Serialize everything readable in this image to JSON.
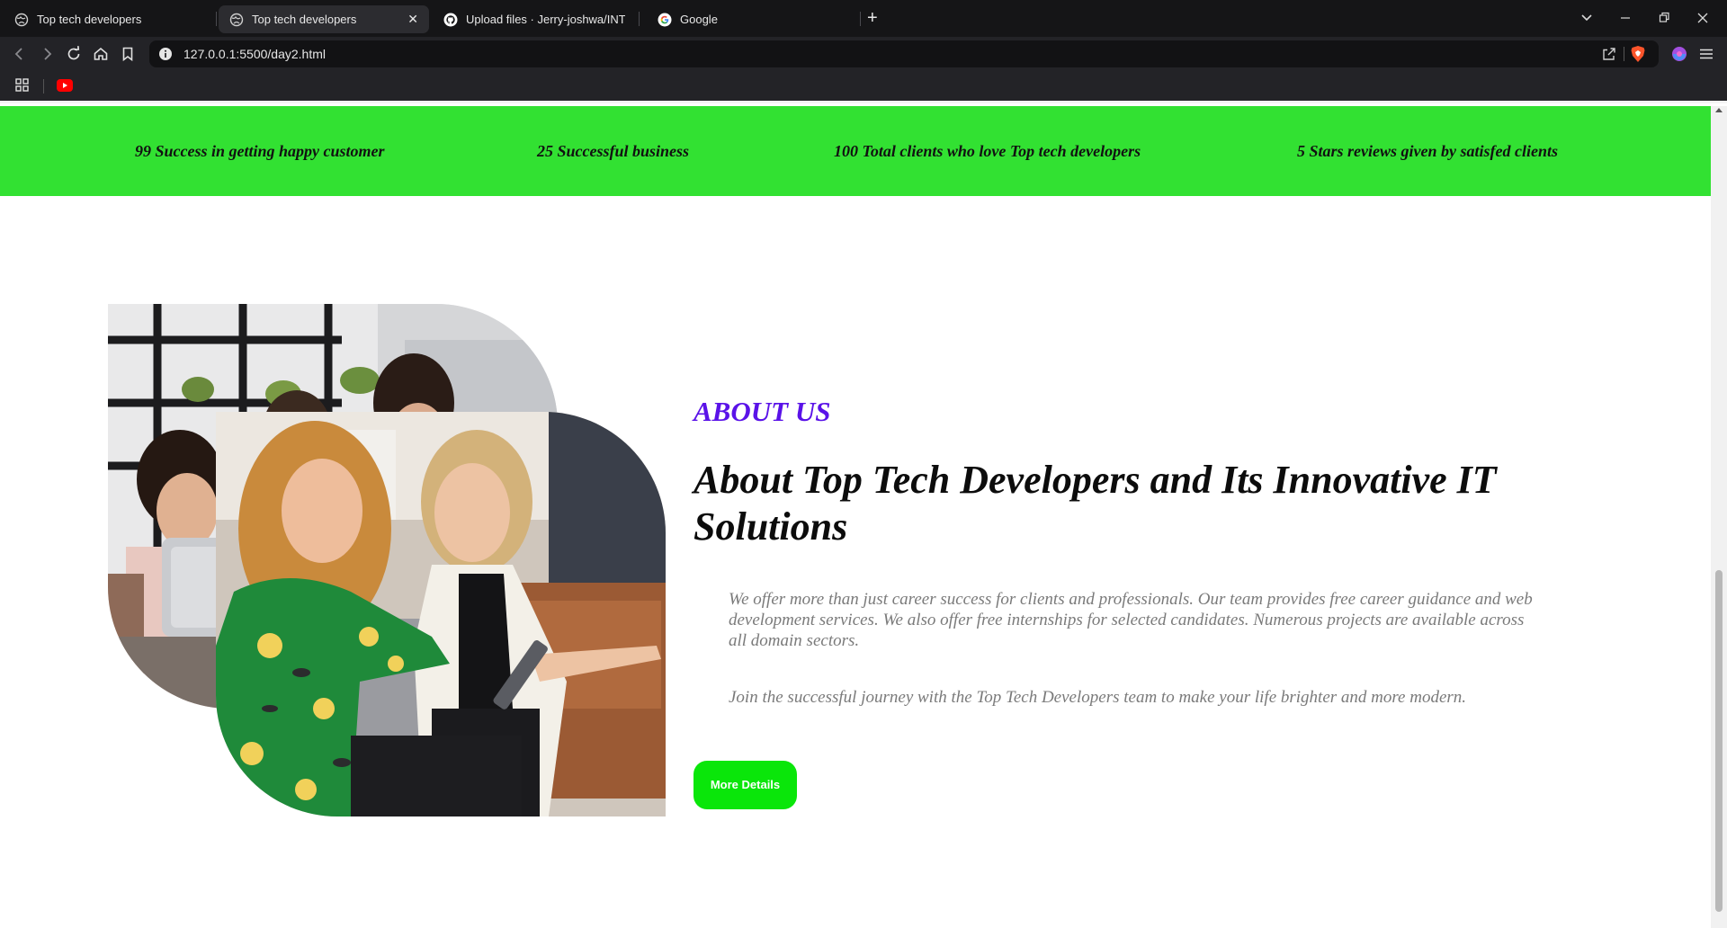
{
  "tabs": [
    {
      "title": "Top tech developers",
      "active": false,
      "icon": "globe-icon"
    },
    {
      "title": "Top tech developers",
      "active": true,
      "icon": "globe-icon"
    },
    {
      "title": "Upload files · Jerry-joshwa/INTERN-",
      "active": false,
      "icon": "github-icon"
    },
    {
      "title": "Google",
      "active": false,
      "icon": "google-icon"
    }
  ],
  "toolbar": {
    "url": "127.0.0.1:5500/day2.html"
  },
  "stats": [
    "99 Success in getting happy customer",
    "25 Successful business",
    "100 Total clients who love Top tech developers",
    "5 Stars reviews given by satisfed clients"
  ],
  "about": {
    "eyebrow": "ABOUT US",
    "title": "About Top Tech Developers and Its Innovative IT Solutions",
    "paragraph1": "We offer more than just career success for clients and professionals. Our team provides free career guidance and web development services. We also offer free internships for selected candidates. Numerous projects are available across all domain sectors.",
    "paragraph2": "Join the successful journey with the Top Tech Developers team to make your life brighter and more modern.",
    "button_label": "More Details"
  },
  "colors": {
    "stats_band": "#32e132",
    "eyebrow": "#5a12e8",
    "button": "#0ae60a"
  }
}
